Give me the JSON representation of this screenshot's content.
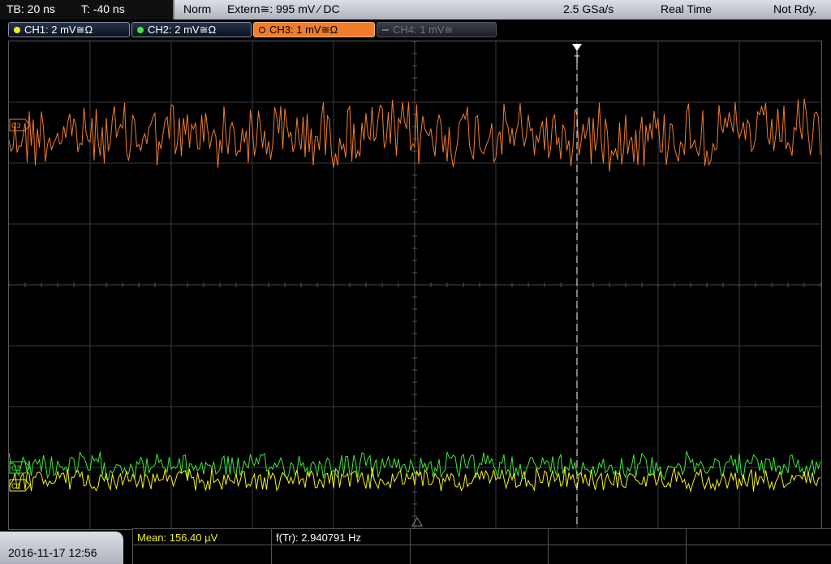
{
  "timebase": {
    "tb": "TB: 20 ns",
    "offset": "T: -40 ns"
  },
  "status": {
    "mode": "Norm",
    "trigger": "Extern≅: 995 mV ⁄ DC",
    "sample_rate": "2.5 GSa/s",
    "acq": "Real Time",
    "ready": "Not Rdy."
  },
  "channels": [
    {
      "label": "CH1: 2 mV≅Ω",
      "color": "#f4f21a",
      "state": "on"
    },
    {
      "label": "CH2: 2 mV≅Ω",
      "color": "#3be83b",
      "state": "on"
    },
    {
      "label": "CH3: 1 mV≅Ω",
      "color": "#f07d2c",
      "state": "active"
    },
    {
      "label": "CH4: 1 mV≅",
      "color": "#6f7480",
      "state": "off"
    }
  ],
  "markers": {
    "trigger": "T",
    "ch3": "C3",
    "ch2": "C2",
    "ch1": "C1"
  },
  "datetime": "2016-11-17 12:56",
  "measurements": {
    "mean": "Mean: 156.40 µV",
    "freq": "f(Tr): 2.940791 Hz"
  },
  "colors": {
    "ch1": "#f4f21a",
    "ch2": "#3be83b",
    "ch3": "#f07d2c",
    "grid": "#3a3a3a",
    "measure_text": "#f4f21a"
  },
  "icons": [
    "trigger-marker-icon",
    "ground-marker-icon",
    "channel-offset-icon"
  ]
}
